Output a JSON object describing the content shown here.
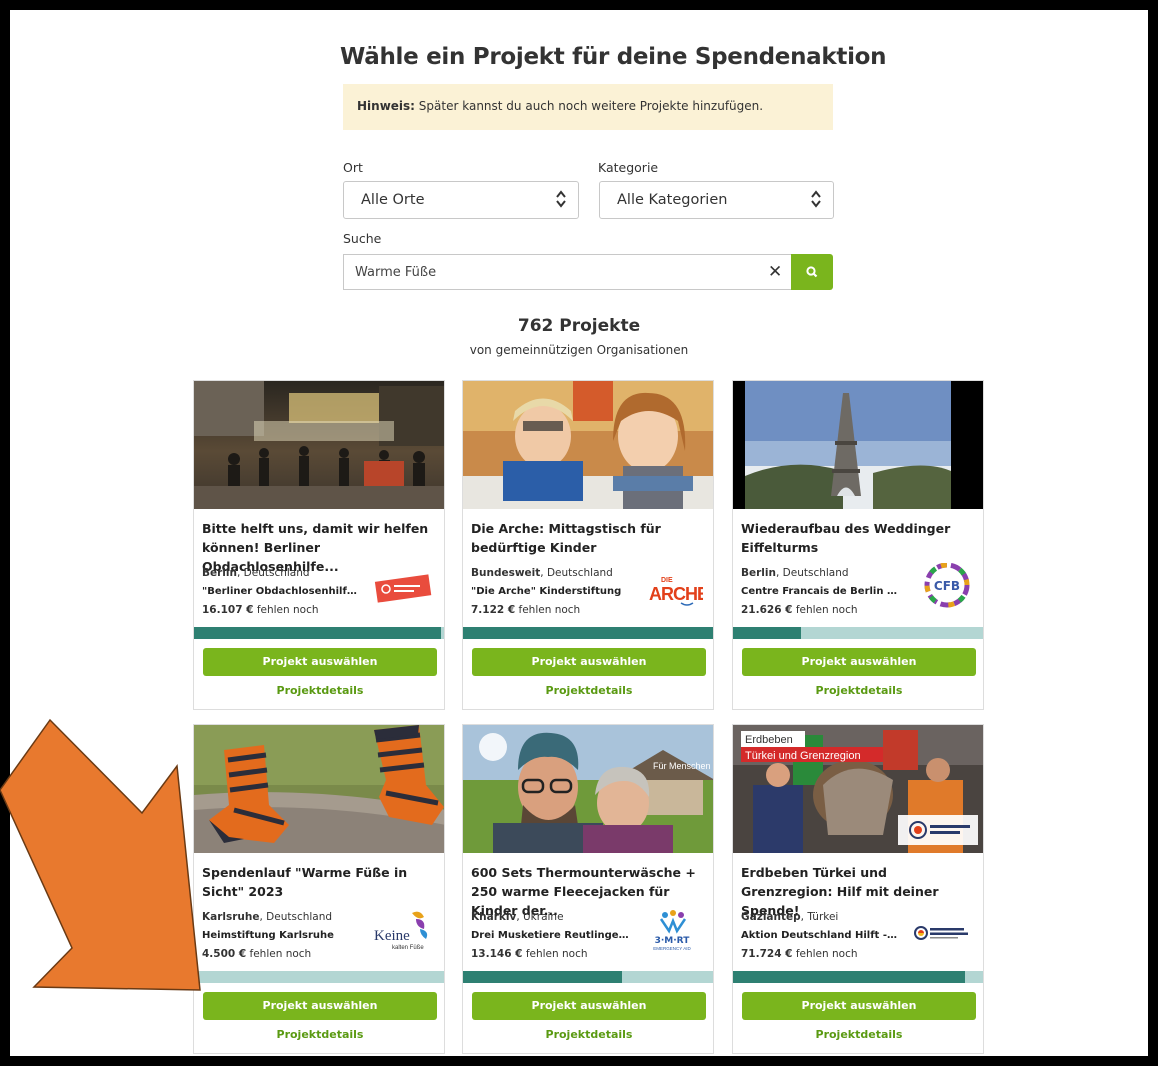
{
  "heading": "Wähle ein Projekt für deine Spendenaktion",
  "hint": {
    "label": "Hinweis:",
    "text": " Später kannst du auch noch weitere Projekte hinzufügen."
  },
  "filters": {
    "ort_label": "Ort",
    "ort_value": "Alle Orte",
    "kategorie_label": "Kategorie",
    "kategorie_value": "Alle Kategorien",
    "suche_label": "Suche",
    "suche_value": "Warme Füße"
  },
  "results": {
    "count": "762 Projekte",
    "subtitle": "von gemeinnützigen Organisationen"
  },
  "buttons": {
    "select": "Projekt auswählen",
    "details": "Projektdetails"
  },
  "cards": [
    {
      "title": "Bitte helft uns, damit wir helfen können! Berliner Obdachlosenhilfe...",
      "city": "Berlin",
      "country": ", Deutschland",
      "org": "\"Berliner Obdachlosenhilfe...",
      "amount": "16.107 €",
      "amount_suffix": " fehlen noch",
      "progress": 0.98
    },
    {
      "title": "Die Arche: Mittagstisch für bedürftige Kinder",
      "city": "Bundesweit",
      "country": ", Deutschland",
      "org": "\"Die Arche\" Kinderstiftung",
      "amount": "7.122 €",
      "amount_suffix": " fehlen noch",
      "progress": 1.0,
      "logo_text": "ARCHE",
      "logo_top": "DIE"
    },
    {
      "title": "Wiederaufbau des Weddinger Eiffelturms",
      "city": "Berlin",
      "country": ", Deutschland",
      "org": "Centre Francais de Berlin g...",
      "amount": "21.626 €",
      "amount_suffix": " fehlen noch",
      "progress": 0.27,
      "logo_text": "CFB"
    },
    {
      "title": "Spendenlauf \"Warme Füße in Sicht\" 2023",
      "city": "Karlsruhe",
      "country": ", Deutschland",
      "org": "Heimstiftung Karlsruhe",
      "amount": "4.500 €",
      "amount_suffix": " fehlen noch",
      "progress": 0.0,
      "logo_text": "Keine",
      "logo_sub": "kalten Füße"
    },
    {
      "title": "600 Sets Thermounterwäsche + 250 warme Fleecejacken für Kinder der...",
      "city": "Kharkiv",
      "country": ", Ukraine",
      "org": "Drei Musketiere Reutlingen ...",
      "amount": "13.146 €",
      "amount_suffix": " fehlen noch",
      "progress": 0.63,
      "logo_text": "3·M·RT",
      "logo_sub": "EMERGENCY AID",
      "image_text": "Für Menschen in der Ukraine"
    },
    {
      "title": "Erdbeben Türkei und Grenzregion: Hilf mit deiner Spende!",
      "city": "Gaziantep",
      "country": ", Türkei",
      "org": "Aktion Deutschland Hilft - ...",
      "amount": "71.724 €",
      "amount_suffix": " fehlen noch",
      "progress": 0.92,
      "image_text_1": "Erdbeben",
      "image_text_2": "Türkei und Grenzregion"
    }
  ],
  "colors": {
    "accent_green": "#7ab51d",
    "progress_teal": "#2e8072",
    "progress_bg": "#b3d6d3",
    "hint_bg": "#fbf2d6",
    "arrow": "#e8792e"
  },
  "icons": {
    "select_caret": "updown-caret-icon",
    "clear": "close-icon",
    "search": "search-icon",
    "annotation": "arrow-annotation-icon"
  }
}
